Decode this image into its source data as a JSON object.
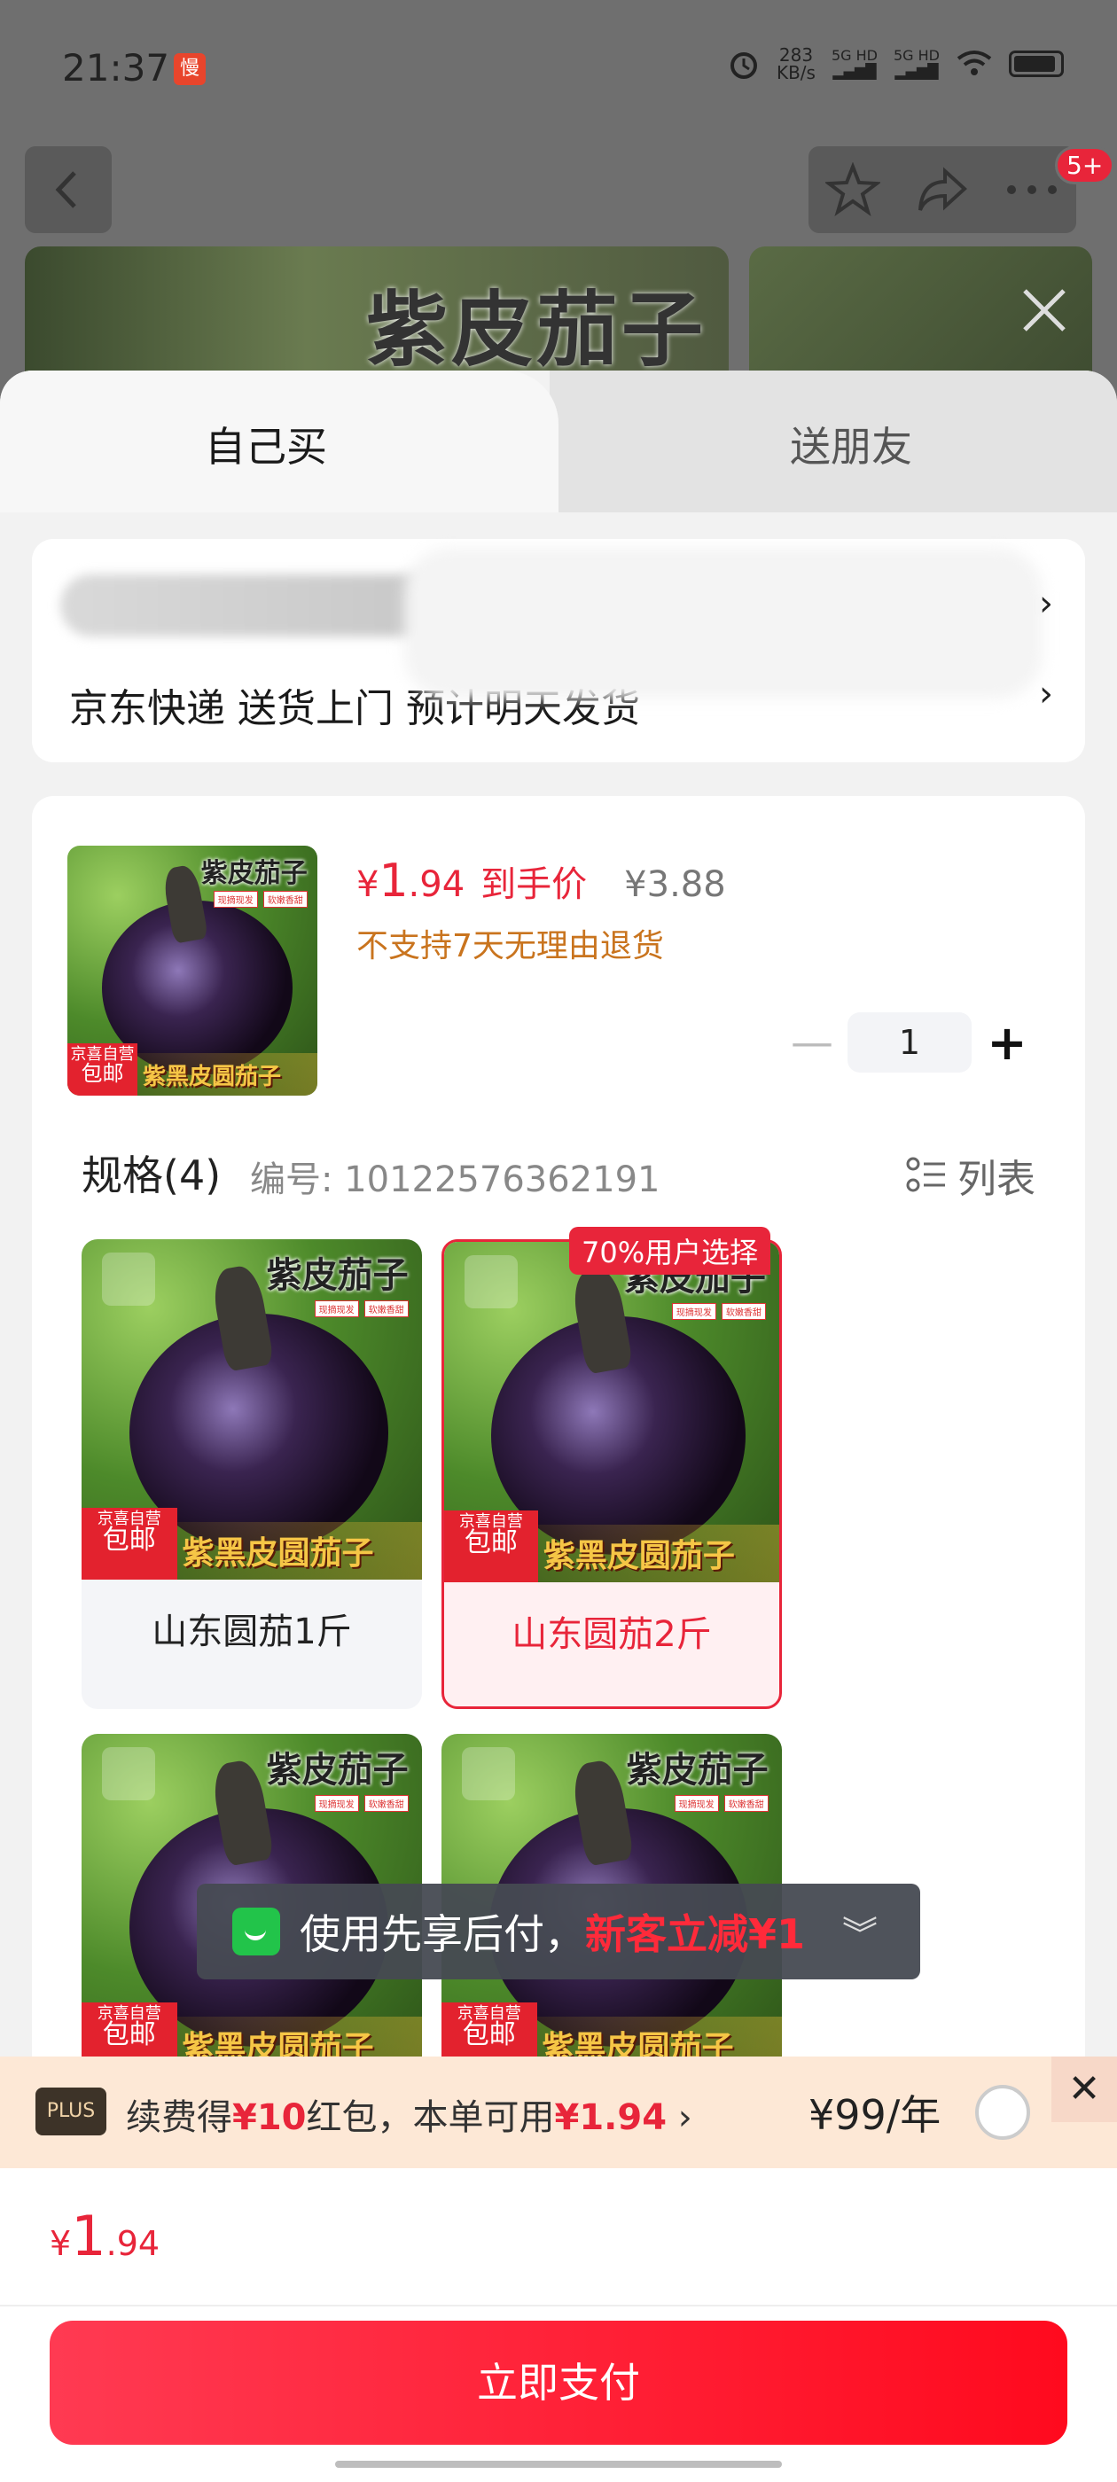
{
  "status_bar": {
    "time": "21:37",
    "app_badge": "慢",
    "speed_value": "283",
    "speed_unit": "KB/s",
    "net1": "5G HD",
    "net2": "5G HD"
  },
  "nav": {
    "more_badge": "5+"
  },
  "hero": {
    "title": "紫皮茄子"
  },
  "tabs": {
    "self_buy": "自己买",
    "gift": "送朋友"
  },
  "delivery": {
    "text": "京东快递 送货上门 预计明天发货"
  },
  "product": {
    "price_symbol": "¥",
    "price_int": "1",
    "price_dec": ".94",
    "price_tag": "到手价",
    "original_price": "¥3.88",
    "return_note": "不支持7天无理由退货",
    "quantity": "1"
  },
  "product_image": {
    "title": "紫皮茄子",
    "chip1": "现摘现发",
    "chip2": "软嫩香甜",
    "free_small": "京喜自营",
    "free": "包邮",
    "name": "紫黑皮圆茄子"
  },
  "specs": {
    "heading": "规格(4)",
    "code": "编号: 10122576362191",
    "view_label": "列表",
    "items": [
      {
        "label": "山东圆茄1斤"
      },
      {
        "label": "山东圆茄2斤",
        "badge": "70%用户选择"
      },
      {
        "label": ""
      },
      {
        "label": ""
      }
    ]
  },
  "toast": {
    "text": "使用先享后付，",
    "promo": "新客立减¥1"
  },
  "plus": {
    "logo": "PLUS",
    "text_a": "续费得",
    "text_b": "¥10",
    "text_c": "红包，本单可用",
    "text_d": "¥1.94",
    "text_e": " ›",
    "price": "¥99/年"
  },
  "footer": {
    "price_symbol": "¥",
    "price_int": "1",
    "price_dec": ".94",
    "pay_label": "立即支付"
  },
  "colors": {
    "accent": "#e8253a",
    "warning": "#c9741e"
  }
}
